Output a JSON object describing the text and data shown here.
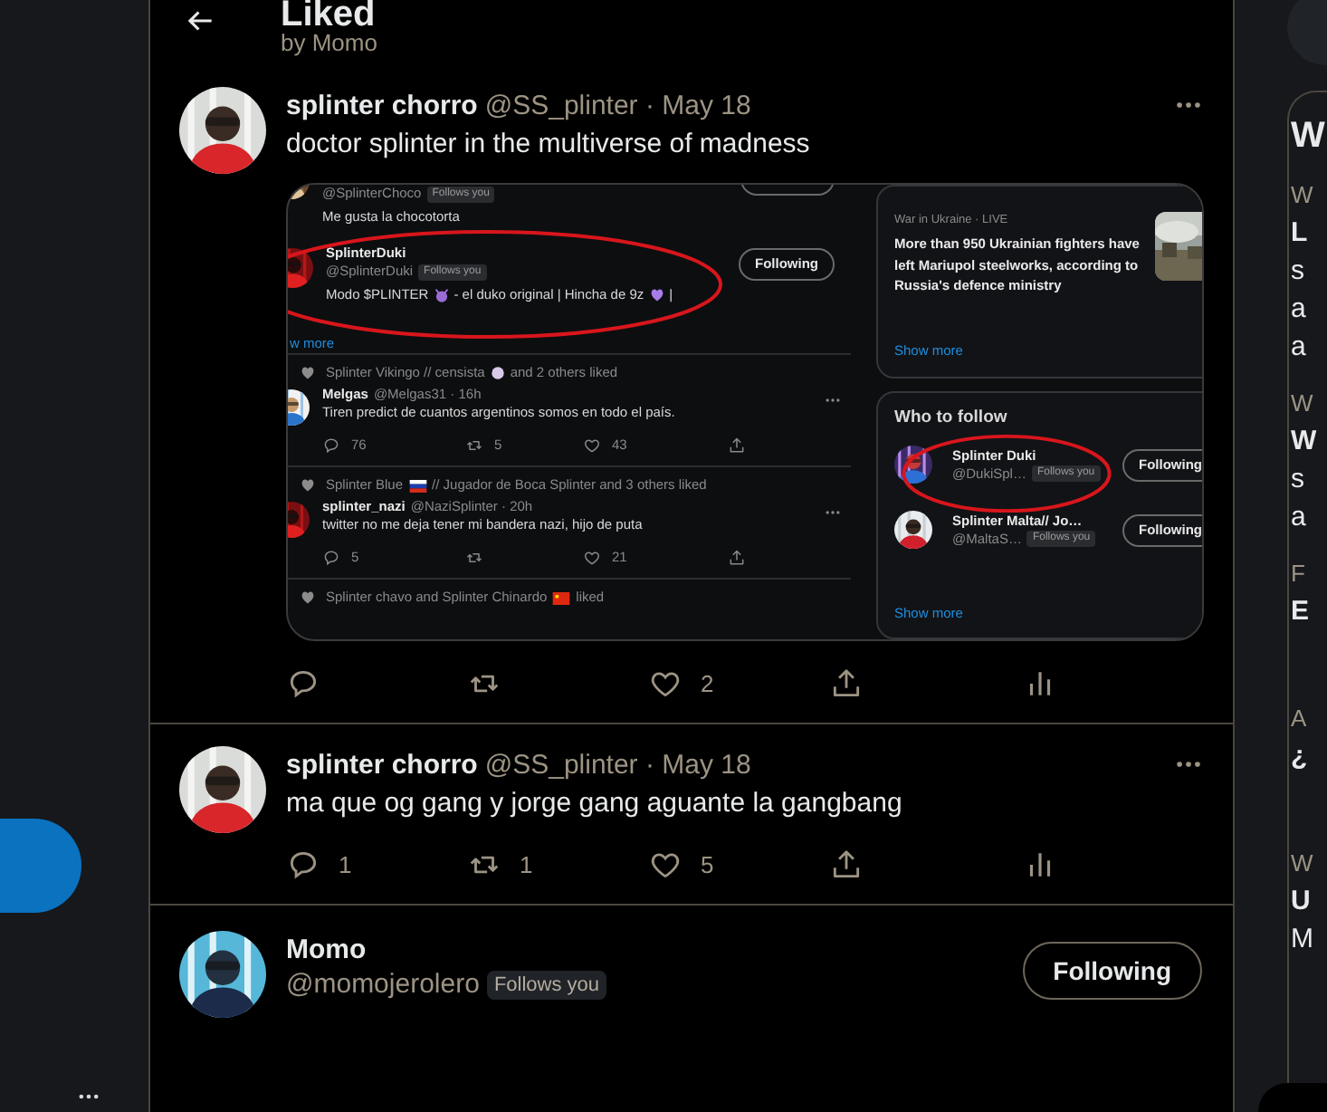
{
  "header": {
    "title": "Liked",
    "subtitle": "by Momo"
  },
  "tweets": [
    {
      "name": "splinter chorro",
      "meta": "@SS_plinter · May 18",
      "text": "doctor splinter in the multiverse of madness",
      "media": {
        "choco": {
          "handle": "@SplinterChoco",
          "badge": "Follows you",
          "bio": "Me gusta la chocotorta"
        },
        "duki": {
          "name": "SplinterDuki",
          "handle": "@SplinterDuki",
          "badge": "Follows you",
          "button": "Following",
          "bio": [
            {
              "kind": "text",
              "text": "Modo $PLINTER"
            },
            {
              "kind": "devil"
            },
            {
              "kind": "text",
              "text": "- el duko original | Hincha de 9z"
            },
            {
              "kind": "heart"
            },
            {
              "kind": "text",
              "text": "|"
            }
          ]
        },
        "show_more": "w more",
        "feed": [
          {
            "liked_by": [
              {
                "kind": "text",
                "text": "Splinter Vikingo // censista"
              },
              {
                "kind": "badge"
              },
              {
                "kind": "text",
                "text": "and 2 others liked"
              }
            ],
            "name": "Melgas",
            "meta": "@Melgas31 · 16h",
            "text": "Tiren predict de cuantos argentinos somos en todo el país.",
            "actions": [
              {
                "kind": "reply",
                "count": "76"
              },
              {
                "kind": "retweet",
                "count": "5"
              },
              {
                "kind": "like",
                "count": "43"
              },
              {
                "kind": "share"
              }
            ]
          },
          {
            "liked_by": [
              {
                "kind": "text",
                "text": "Splinter Blue"
              },
              {
                "kind": "flag_ru"
              },
              {
                "kind": "text",
                "text": "// Jugador de Boca Splinter and 3 others liked"
              }
            ],
            "name": "splinter_nazi",
            "meta": "@NaziSplinter · 20h",
            "text": "twitter no me deja tener mi bandera nazi, hijo de puta",
            "actions": [
              {
                "kind": "reply",
                "count": "5"
              },
              {
                "kind": "retweet"
              },
              {
                "kind": "like",
                "count": "21"
              },
              {
                "kind": "share"
              }
            ]
          },
          {
            "liked_by": [
              {
                "kind": "text",
                "text": "Splinter chavo and Splinter Chinardo"
              },
              {
                "kind": "flag_cn"
              },
              {
                "kind": "text",
                "text": "liked"
              }
            ]
          }
        ],
        "news": {
          "context": "War in Ukraine · LIVE",
          "headline": "More than 950 Ukrainian fighters have left Mariupol steelworks, according to Russia's defence ministry",
          "link": "Show more"
        },
        "who_to_follow": {
          "title": "Who to follow",
          "users": [
            {
              "name": "Splinter Duki",
              "handle": "@DukiSpl…",
              "badge": "Follows you",
              "button": "Following"
            },
            {
              "name": "Splinter Malta// Jo…",
              "handle": "@MaltaS…",
              "badge": "Follows you",
              "button": "Following"
            }
          ],
          "link": "Show more"
        }
      },
      "actions": [
        {
          "kind": "reply"
        },
        {
          "kind": "retweet"
        },
        {
          "kind": "like",
          "count": "2"
        },
        {
          "kind": "share"
        },
        {
          "kind": "analytics"
        }
      ]
    },
    {
      "name": "splinter chorro",
      "meta": "@SS_plinter · May 18",
      "text": "ma que og gang y jorge gang aguante la gangbang",
      "actions": [
        {
          "kind": "reply",
          "count": "1"
        },
        {
          "kind": "retweet",
          "count": "1"
        },
        {
          "kind": "like",
          "count": "5"
        },
        {
          "kind": "share"
        },
        {
          "kind": "analytics"
        }
      ]
    }
  ],
  "user_card": {
    "name": "Momo",
    "handle": "@momojerolero",
    "badge": "Follows you",
    "button": "Following"
  },
  "right_panel": {
    "title": "W",
    "groups": [
      {
        "context": "W",
        "headline": "L",
        "lines": [
          "s",
          "a",
          "a"
        ]
      },
      {
        "context": "W",
        "headline": "W",
        "lines": [
          "s",
          "a"
        ]
      },
      {
        "context": "F",
        "headline": "E"
      },
      {
        "context": "A",
        "headline": "¿"
      },
      {
        "context": "W",
        "headline": "U",
        "lines": [
          "M"
        ]
      }
    ]
  }
}
